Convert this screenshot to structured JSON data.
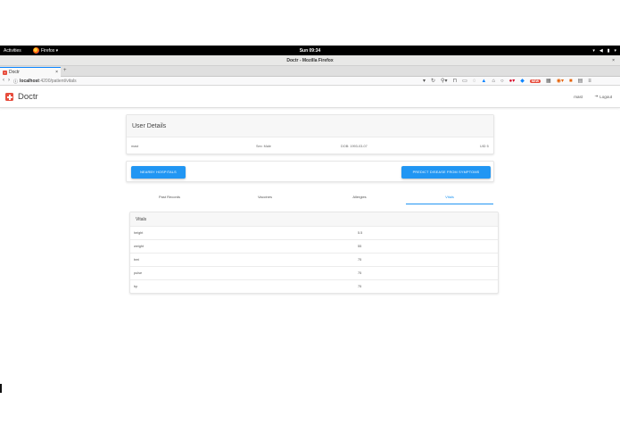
{
  "system_bar": {
    "activities": "Activities",
    "app_menu": "Firefox ▾",
    "clock": "Sun 09:34",
    "icons": [
      "network-icon",
      "volume-icon",
      "battery-icon",
      "power-menu-icon"
    ]
  },
  "window": {
    "title": "Doctr - Mozilla Firefox",
    "close": "×"
  },
  "browser": {
    "tab_title": "Doctr",
    "tab_close": "×",
    "new_tab": "+",
    "url_host": "localhost",
    "url_path": ":4200/patient/vitals",
    "badge": "NEW"
  },
  "app": {
    "brand": "Doctr",
    "user": "mast",
    "logout": "Logout"
  },
  "user_details": {
    "title": "User Details",
    "name": "mast",
    "sex": "Sex: Male",
    "dob": "DOB: 1993-03-07",
    "uid": "UID 5"
  },
  "actions": {
    "nearby_hospitals": "NEARBY HOSPITALS",
    "predict": "PREDICT DISEASE FROM SYMPTOMS"
  },
  "tabs": [
    {
      "label": "Past Records",
      "active": false
    },
    {
      "label": "Vaccines",
      "active": false
    },
    {
      "label": "Allergies",
      "active": false
    },
    {
      "label": "Vitals",
      "active": true
    }
  ],
  "vitals": {
    "title": "Vitals",
    "rows": [
      {
        "key": "height",
        "value": "5.5"
      },
      {
        "key": "weight",
        "value": "55"
      },
      {
        "key": "bmi",
        "value": "75"
      },
      {
        "key": "pulse",
        "value": "75"
      },
      {
        "key": "bp",
        "value": "75"
      }
    ]
  },
  "colors": {
    "accent": "#2196f3",
    "brand": "#e74c3c"
  }
}
